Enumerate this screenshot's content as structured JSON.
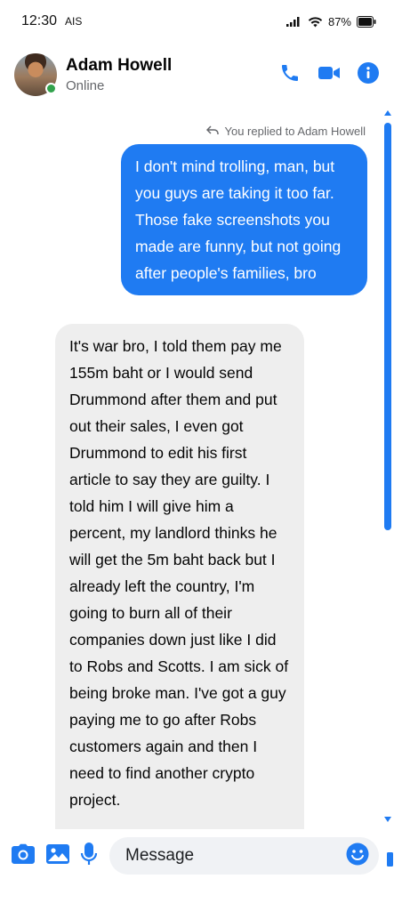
{
  "status_bar": {
    "time": "12:30",
    "carrier": "AIS",
    "battery": "87%"
  },
  "header": {
    "contact_name": "Adam Howell",
    "contact_status": "Online",
    "icons": [
      "back-avatar",
      "phone-icon",
      "video-icon",
      "info-icon"
    ]
  },
  "conversation": {
    "reply_note": "You replied to Adam Howell",
    "outgoing_message": "I don't mind trolling, man, but you guys are taking it too far. Those fake screenshots you made are funny, but not going after people's families, bro",
    "incoming_message": "It's war bro, I told them pay me 155m baht or I would send Drummond after them and put out their sales, I even got Drummond to edit his first article to say they are guilty. I told him I will give him a percent, my landlord thinks he will get the 5m baht back but I already left the country, I'm going to burn all of their companies down just like I did to Robs and Scotts. I am sick of being broke man. I've got a guy paying me to go after Robs customers again and then I need to find another crypto project."
  },
  "composer": {
    "placeholder": "Message",
    "icons": [
      "camera-icon",
      "image-icon",
      "microphone-icon",
      "emoji-icon",
      "thumbs-up-icon"
    ]
  },
  "colors": {
    "accent": "#1f7bf2",
    "incoming_bubble": "#eeeeee",
    "online": "#31a24c"
  }
}
